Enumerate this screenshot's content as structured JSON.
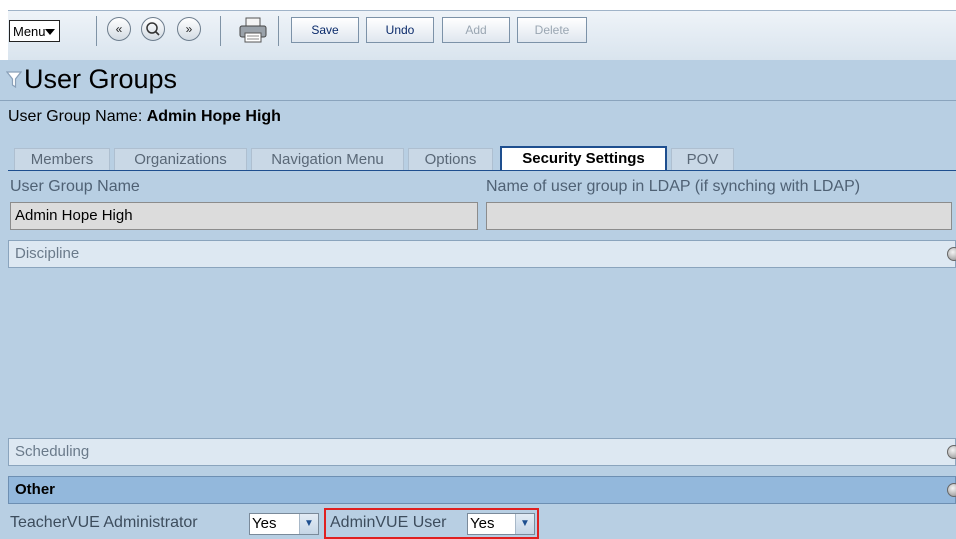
{
  "toolbar": {
    "menu_label": "Menu",
    "prev_glyph": "«",
    "next_glyph": "»",
    "save_label": "Save",
    "undo_label": "Undo",
    "add_label": "Add",
    "delete_label": "Delete"
  },
  "page": {
    "title": "User Groups",
    "group_name_label": "User Group Name:",
    "group_name_value": "Admin Hope High"
  },
  "tabs": [
    {
      "label": "Members"
    },
    {
      "label": "Organizations"
    },
    {
      "label": "Navigation Menu"
    },
    {
      "label": "Options"
    },
    {
      "label": "Security Settings",
      "active": true
    },
    {
      "label": "POV"
    }
  ],
  "form": {
    "group_name_label": "User Group Name",
    "group_name_value": "Admin Hope High",
    "ldap_label": "Name of user group in LDAP (if synching with LDAP)",
    "ldap_value": ""
  },
  "sections": {
    "discipline": "Discipline",
    "scheduling": "Scheduling",
    "other": "Other"
  },
  "other": {
    "teachervue_admin_label": "TeacherVUE Administrator",
    "teachervue_admin_value": "Yes",
    "adminvue_user_label": "AdminVUE User",
    "adminvue_user_value": "Yes"
  },
  "colors": {
    "background": "#b8cfe3",
    "active_tab_border": "#1e4f8f",
    "highlight_box": "#e02020",
    "other_header": "#93b8dc"
  },
  "icons": [
    "chevron-down-icon",
    "previous-icon",
    "search-icon",
    "next-icon",
    "printer-icon",
    "filter-icon",
    "section-toggle-icon"
  ]
}
